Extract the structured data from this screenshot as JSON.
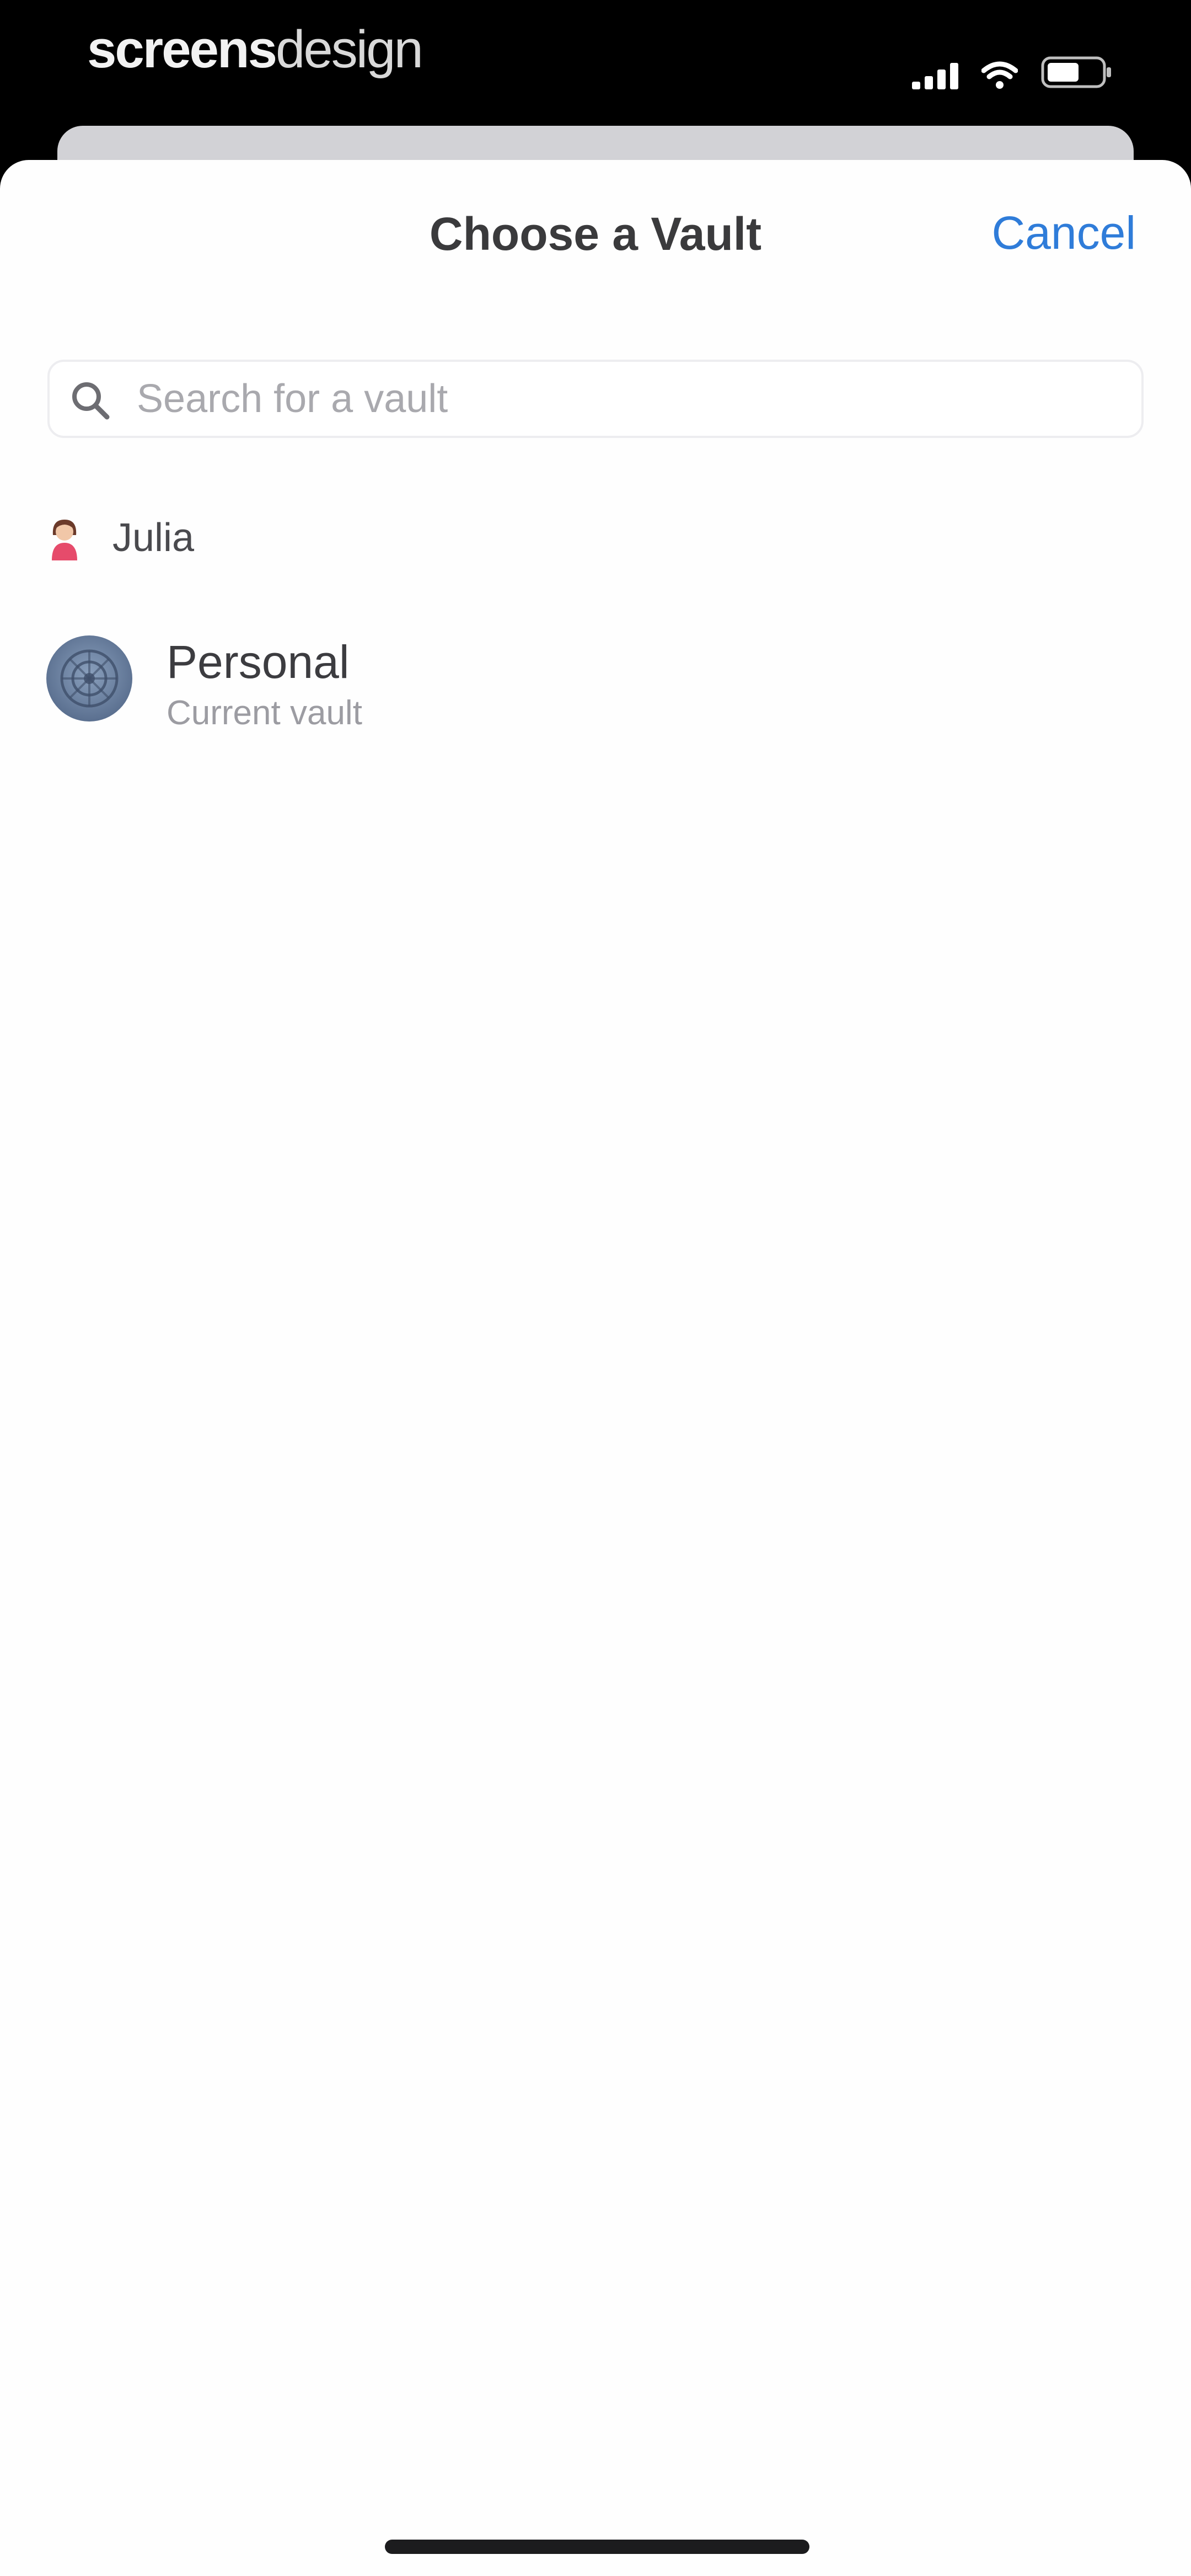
{
  "status_bar": {
    "brand_part1": "screens",
    "brand_part2": "design",
    "signal_icon": "cellular-signal-icon",
    "wifi_icon": "wifi-icon",
    "battery_icon": "battery-icon"
  },
  "sheet": {
    "title": "Choose a Vault",
    "cancel_label": "Cancel",
    "accent_color": "#2f7cd9"
  },
  "search": {
    "placeholder": "Search for a vault",
    "value": "",
    "icon": "search-icon"
  },
  "account": {
    "name": "Julia",
    "avatar_icon": "person-avatar-icon"
  },
  "vaults": [
    {
      "name": "Personal",
      "subtitle": "Current vault",
      "icon": "vault-icon"
    }
  ]
}
